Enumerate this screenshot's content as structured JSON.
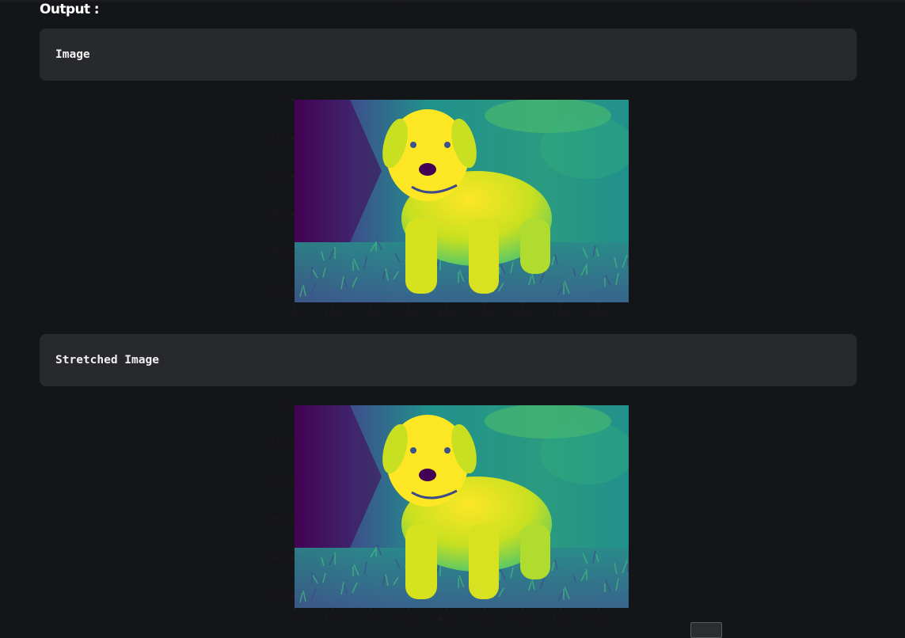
{
  "output": {
    "heading": "Output :"
  },
  "blocks": [
    {
      "label": "Image"
    },
    {
      "label": "Stretched Image"
    }
  ],
  "plot": {
    "x_ticks": [
      "0",
      "100",
      "200",
      "300",
      "400",
      "500",
      "600",
      "700",
      "800"
    ],
    "y_ticks": [
      "0",
      "100",
      "200",
      "300",
      "400",
      "500"
    ],
    "colormap": "viridis",
    "image_subject": "puppy-in-grass"
  },
  "colors": {
    "background": "#141519",
    "code_block": "#28292d",
    "viridis_dark": "#440154",
    "viridis_teal": "#21918c",
    "viridis_green": "#5ec962",
    "viridis_yellow": "#fde725"
  }
}
